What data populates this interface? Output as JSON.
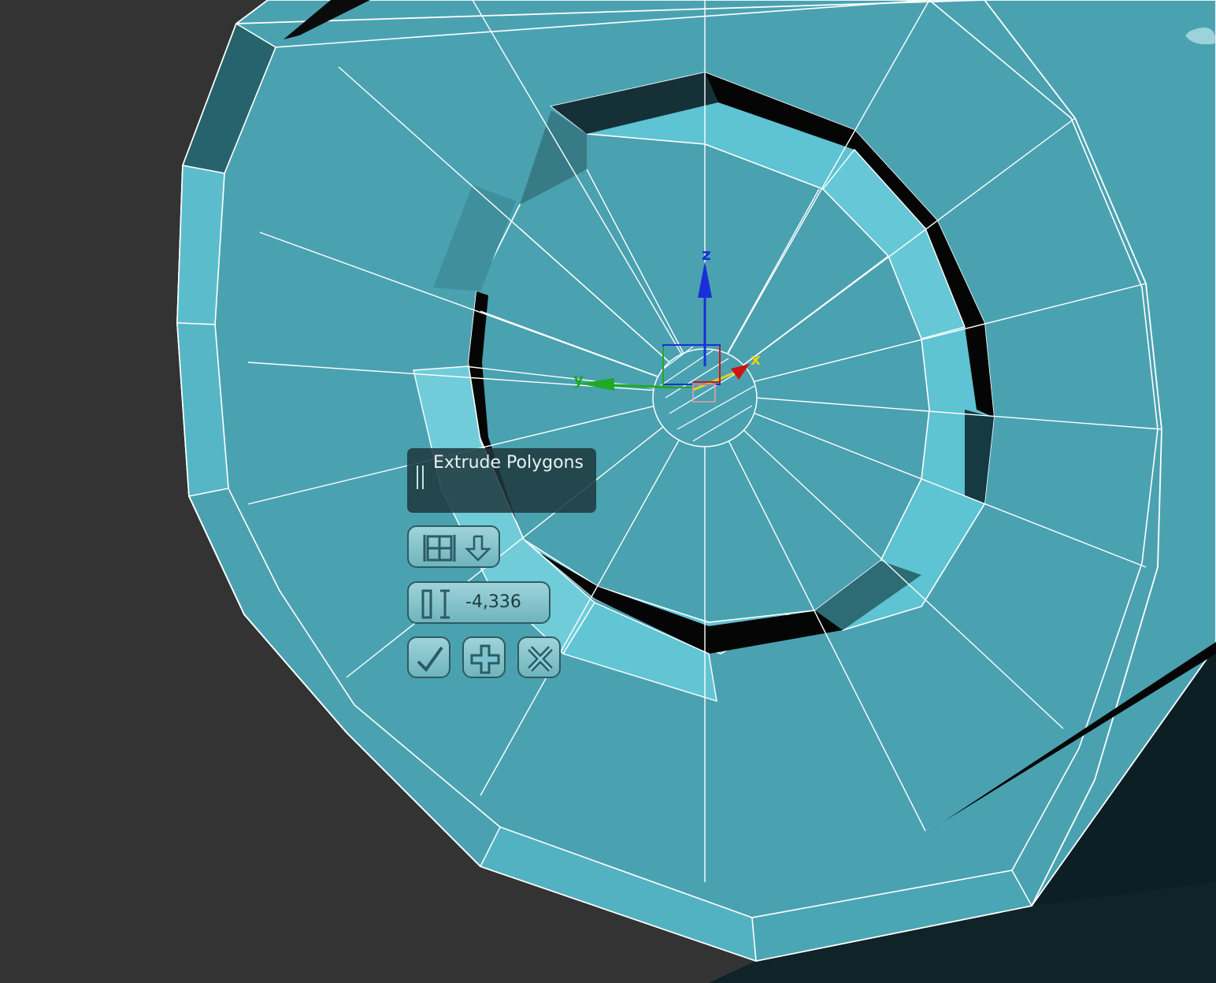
{
  "viewport": {
    "background_color": "#333333",
    "mesh_color": "#4ba2b0",
    "mesh_highlight_color": "#5ec2d2",
    "wire_color": "#ffffff",
    "gizmo": {
      "x_label": "x",
      "y_label": "y",
      "z_label": "z"
    }
  },
  "caddy": {
    "title": "Extrude Polygons",
    "mode_icon": "extrude-group-icon",
    "mode_arrow_icon": "arrow-down-icon",
    "height_icon": "height-icon",
    "height_value": "-4,336",
    "ok_icon": "check-icon",
    "apply_icon": "plus-icon",
    "cancel_icon": "close-icon"
  }
}
